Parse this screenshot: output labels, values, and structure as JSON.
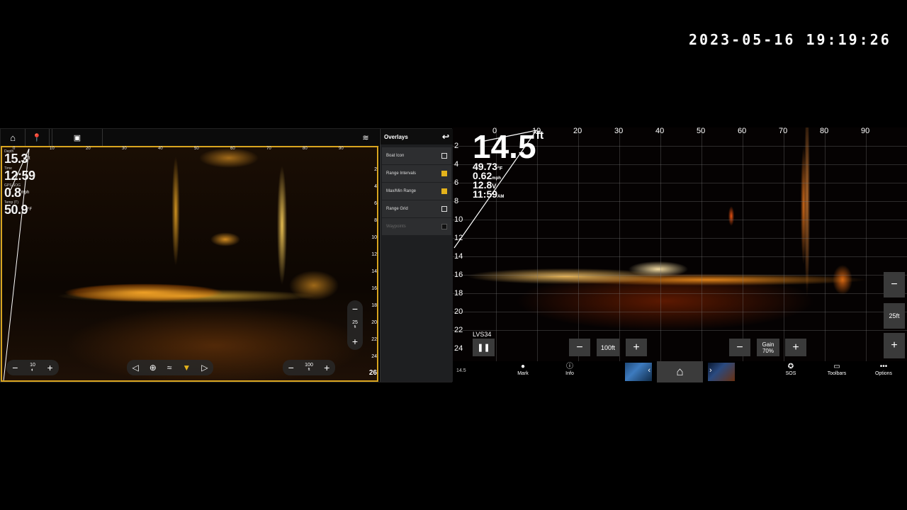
{
  "timestamp": "2023-05-16 19:19:26",
  "left": {
    "scale_labels": [
      "0",
      "10",
      "20",
      "30",
      "40",
      "50",
      "60",
      "70",
      "80",
      "90"
    ],
    "depth_labels": [
      "2",
      "4",
      "6",
      "8",
      "10",
      "12",
      "14",
      "16",
      "18",
      "20",
      "22",
      "24",
      "26"
    ],
    "readouts": [
      {
        "label": "Depth",
        "value": "15.3",
        "unit": "ft"
      },
      {
        "label": "Time",
        "value": "12:59",
        "unit": ""
      },
      {
        "label": "GPS SOG",
        "value": "0.8",
        "unit": "mph"
      },
      {
        "label": "Temp (T)",
        "value": "50.9",
        "unit": "°F"
      }
    ],
    "brightness": {
      "value": "10",
      "minus": "−",
      "plus": "+"
    },
    "range": {
      "value": "100",
      "unit": "ft",
      "minus": "−",
      "plus": "+"
    },
    "zoom": {
      "value": "25",
      "unit": "ft",
      "minus": "−",
      "plus": "+"
    },
    "corner_depth": "26"
  },
  "overlays": {
    "title": "Overlays",
    "items": [
      {
        "label": "Boat Icon",
        "checked": false
      },
      {
        "label": "Range Intervals",
        "checked": true
      },
      {
        "label": "Max/Min Range",
        "checked": true
      },
      {
        "label": "Range Grid",
        "checked": false
      },
      {
        "label": "Waypoints",
        "checked": false
      }
    ]
  },
  "right": {
    "scale_labels": [
      "0",
      "10",
      "20",
      "30",
      "40",
      "50",
      "60",
      "70",
      "80",
      "90"
    ],
    "depth_labels": [
      "2",
      "4",
      "6",
      "8",
      "10",
      "12",
      "14",
      "16",
      "18",
      "20",
      "22",
      "24"
    ],
    "depth": "14.5",
    "depth_unit": "ft",
    "temp": "49.73",
    "temp_unit": "°F",
    "speed": "0.62",
    "speed_unit": "mph",
    "voltage": "12.8",
    "voltage_unit": "V",
    "time": "11:59",
    "time_unit": "AM",
    "source": "LVS34",
    "range_label": "100ft",
    "gain_label": "Gain",
    "gain_value": "70%",
    "zoom_label": "25ft",
    "bottom_depth": "14.5"
  },
  "bottombar": {
    "mark": "Mark",
    "info": "Info",
    "sos": "SOS",
    "toolbars": "Toolbars",
    "options": "Options"
  }
}
